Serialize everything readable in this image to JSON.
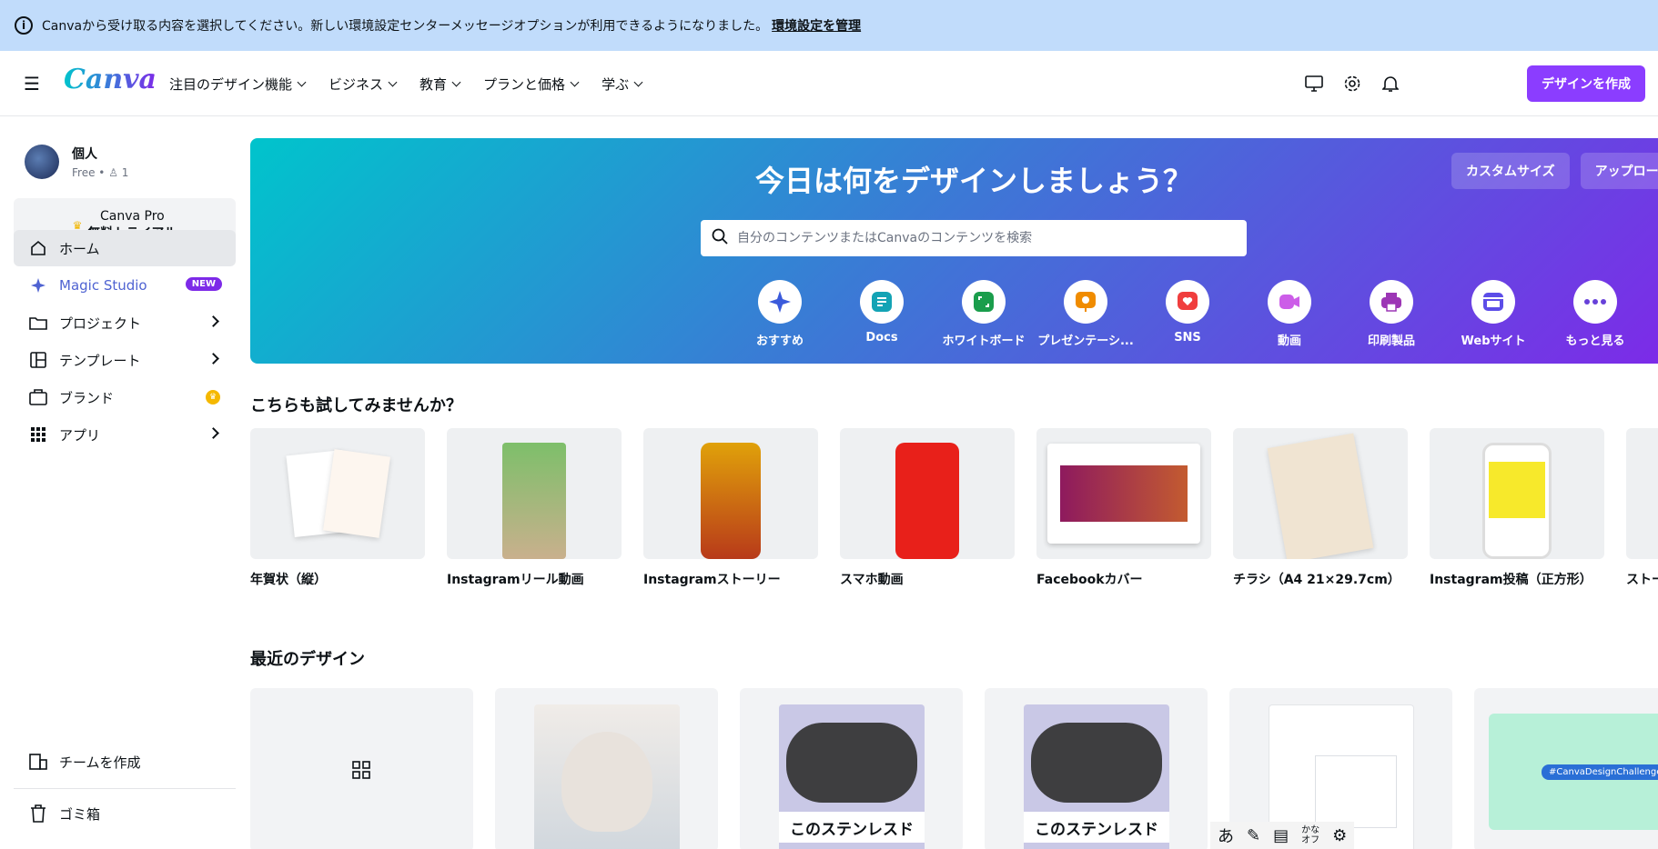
{
  "notice": {
    "text": "Canvaから受け取る内容を選択してください。新しい環境設定センターメッセージオプションが利用できるようになりました。",
    "link": "環境設定を管理"
  },
  "header": {
    "logo": "Canva",
    "nav": [
      {
        "label": "注目のデザイン機能"
      },
      {
        "label": "ビジネス"
      },
      {
        "label": "教育"
      },
      {
        "label": "プランと価格"
      },
      {
        "label": "学ぶ"
      }
    ],
    "create_button": "デザインを作成"
  },
  "sidebar": {
    "account_name": "個人",
    "account_plan": "Free",
    "member_count": "1",
    "pro_line1": "Canva Pro",
    "pro_line2": "無料トライアル",
    "items": [
      {
        "label": "ホーム"
      },
      {
        "label": "Magic Studio",
        "badge": "NEW"
      },
      {
        "label": "プロジェクト"
      },
      {
        "label": "テンプレート"
      },
      {
        "label": "ブランド"
      },
      {
        "label": "アプリ"
      }
    ],
    "bottom": [
      {
        "label": "チームを作成"
      },
      {
        "label": "ゴミ箱"
      }
    ]
  },
  "hero": {
    "title": "今日は何をデザインしましょう？",
    "custom_size": "カスタムサイズ",
    "upload": "アップロード",
    "search_placeholder": "自分のコンテンツまたはCanvaのコンテンツを検索",
    "categories": [
      {
        "label": "おすすめ",
        "icon": "sparkle-icon",
        "color": "#3b5bdb"
      },
      {
        "label": "Docs",
        "icon": "docs-icon",
        "color": "#13a3b5"
      },
      {
        "label": "ホワイトボード",
        "icon": "whiteboard-icon",
        "color": "#1a9d4c"
      },
      {
        "label": "プレゼンテーシ...",
        "icon": "presentation-icon",
        "color": "#f08c00"
      },
      {
        "label": "SNS",
        "icon": "heart-icon",
        "color": "#f03e3e"
      },
      {
        "label": "動画",
        "icon": "video-icon",
        "color": "#cc5de8"
      },
      {
        "label": "印刷製品",
        "icon": "print-icon",
        "color": "#9c36b5"
      },
      {
        "label": "Webサイト",
        "icon": "website-icon",
        "color": "#5c4de8"
      },
      {
        "label": "もっと見る",
        "icon": "more-icon",
        "color": "#6741d9"
      }
    ]
  },
  "try_section": {
    "title": "こちらも試してみませんか？",
    "templates": [
      {
        "label": "年賀状（縦）"
      },
      {
        "label": "Instagramリール動画"
      },
      {
        "label": "Instagramストーリー"
      },
      {
        "label": "スマホ動画"
      },
      {
        "label": "Facebookカバー"
      },
      {
        "label": "チラシ（A4 21×29.7cm）"
      },
      {
        "label": "Instagram投稿（正方形）"
      },
      {
        "label": "ストーリー"
      }
    ]
  },
  "recent_section": {
    "title": "最近のデザイン",
    "items": [
      {
        "caption": ""
      },
      {
        "caption": ""
      },
      {
        "caption": "このステンレスド"
      },
      {
        "caption": "このステンレスド"
      },
      {
        "caption": ""
      },
      {
        "caption": "#CanvaDesignChallenge"
      }
    ]
  },
  "ime": {
    "char": "あ",
    "kana_top": "かな",
    "kana_bottom": "オフ"
  }
}
